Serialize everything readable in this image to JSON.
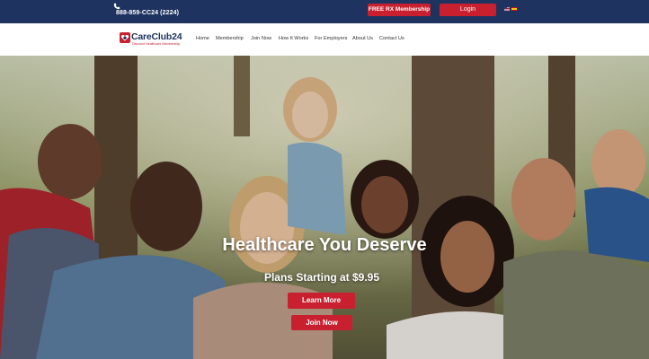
{
  "topbar": {
    "phone": "888-859-CC24 (2224)",
    "free_rx_label": "FREE RX Membership",
    "login_label": "Login"
  },
  "logo": {
    "name": "CareClub24",
    "tagline": "Discount Healthcare Membership"
  },
  "nav": {
    "items": [
      "Home",
      "Membership",
      "Join Now",
      "How It Works",
      "For Employers",
      "About Us",
      "Contact Us"
    ]
  },
  "hero": {
    "title": "Healthcare You Deserve",
    "subtitle": "Plans Starting at $9.95",
    "learn_more_label": "Learn More",
    "join_now_label": "Join Now"
  },
  "colors": {
    "navy": "#1f3361",
    "brand_red": "#c8202f"
  }
}
